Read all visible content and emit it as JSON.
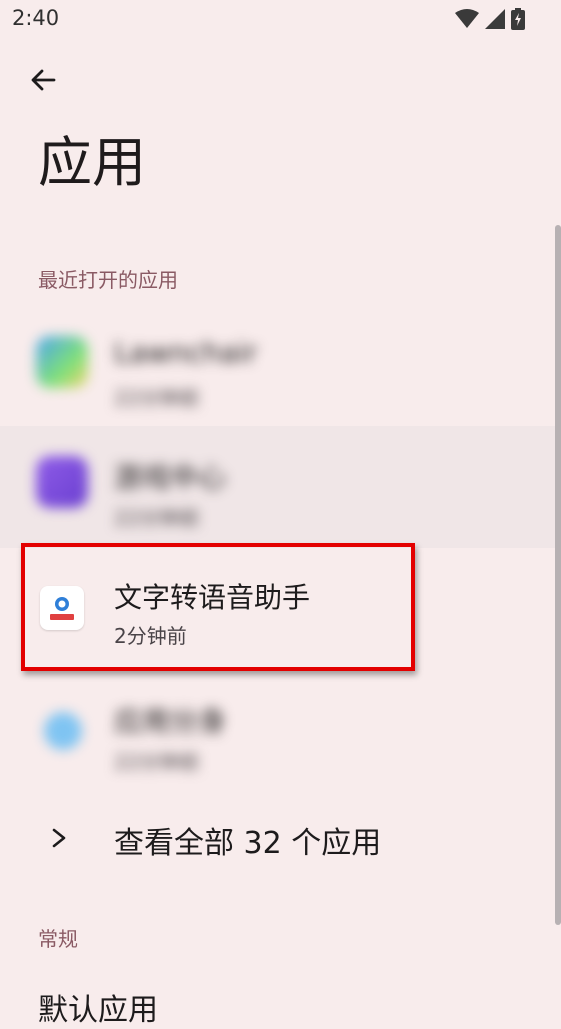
{
  "status": {
    "time": "2:40"
  },
  "header": {
    "title": "应用"
  },
  "recent": {
    "label": "最近打开的应用",
    "apps": [
      {
        "name": "Lawnchair",
        "time": "22分钟前",
        "blurred": true
      },
      {
        "name": "游戏中心",
        "time": "22分钟前",
        "blurred": true
      },
      {
        "name": "文字转语音助手",
        "time": "2分钟前",
        "blurred": false
      },
      {
        "name": "应用分身",
        "time": "22分钟前",
        "blurred": true
      }
    ]
  },
  "see_all": {
    "label": "查看全部 32 个应用"
  },
  "general": {
    "label": "常规"
  },
  "footer_cut": {
    "label": "默认应用"
  },
  "colors": {
    "background": "#f8ecec",
    "section_label": "#8a5a64",
    "highlight": "#e30000"
  }
}
